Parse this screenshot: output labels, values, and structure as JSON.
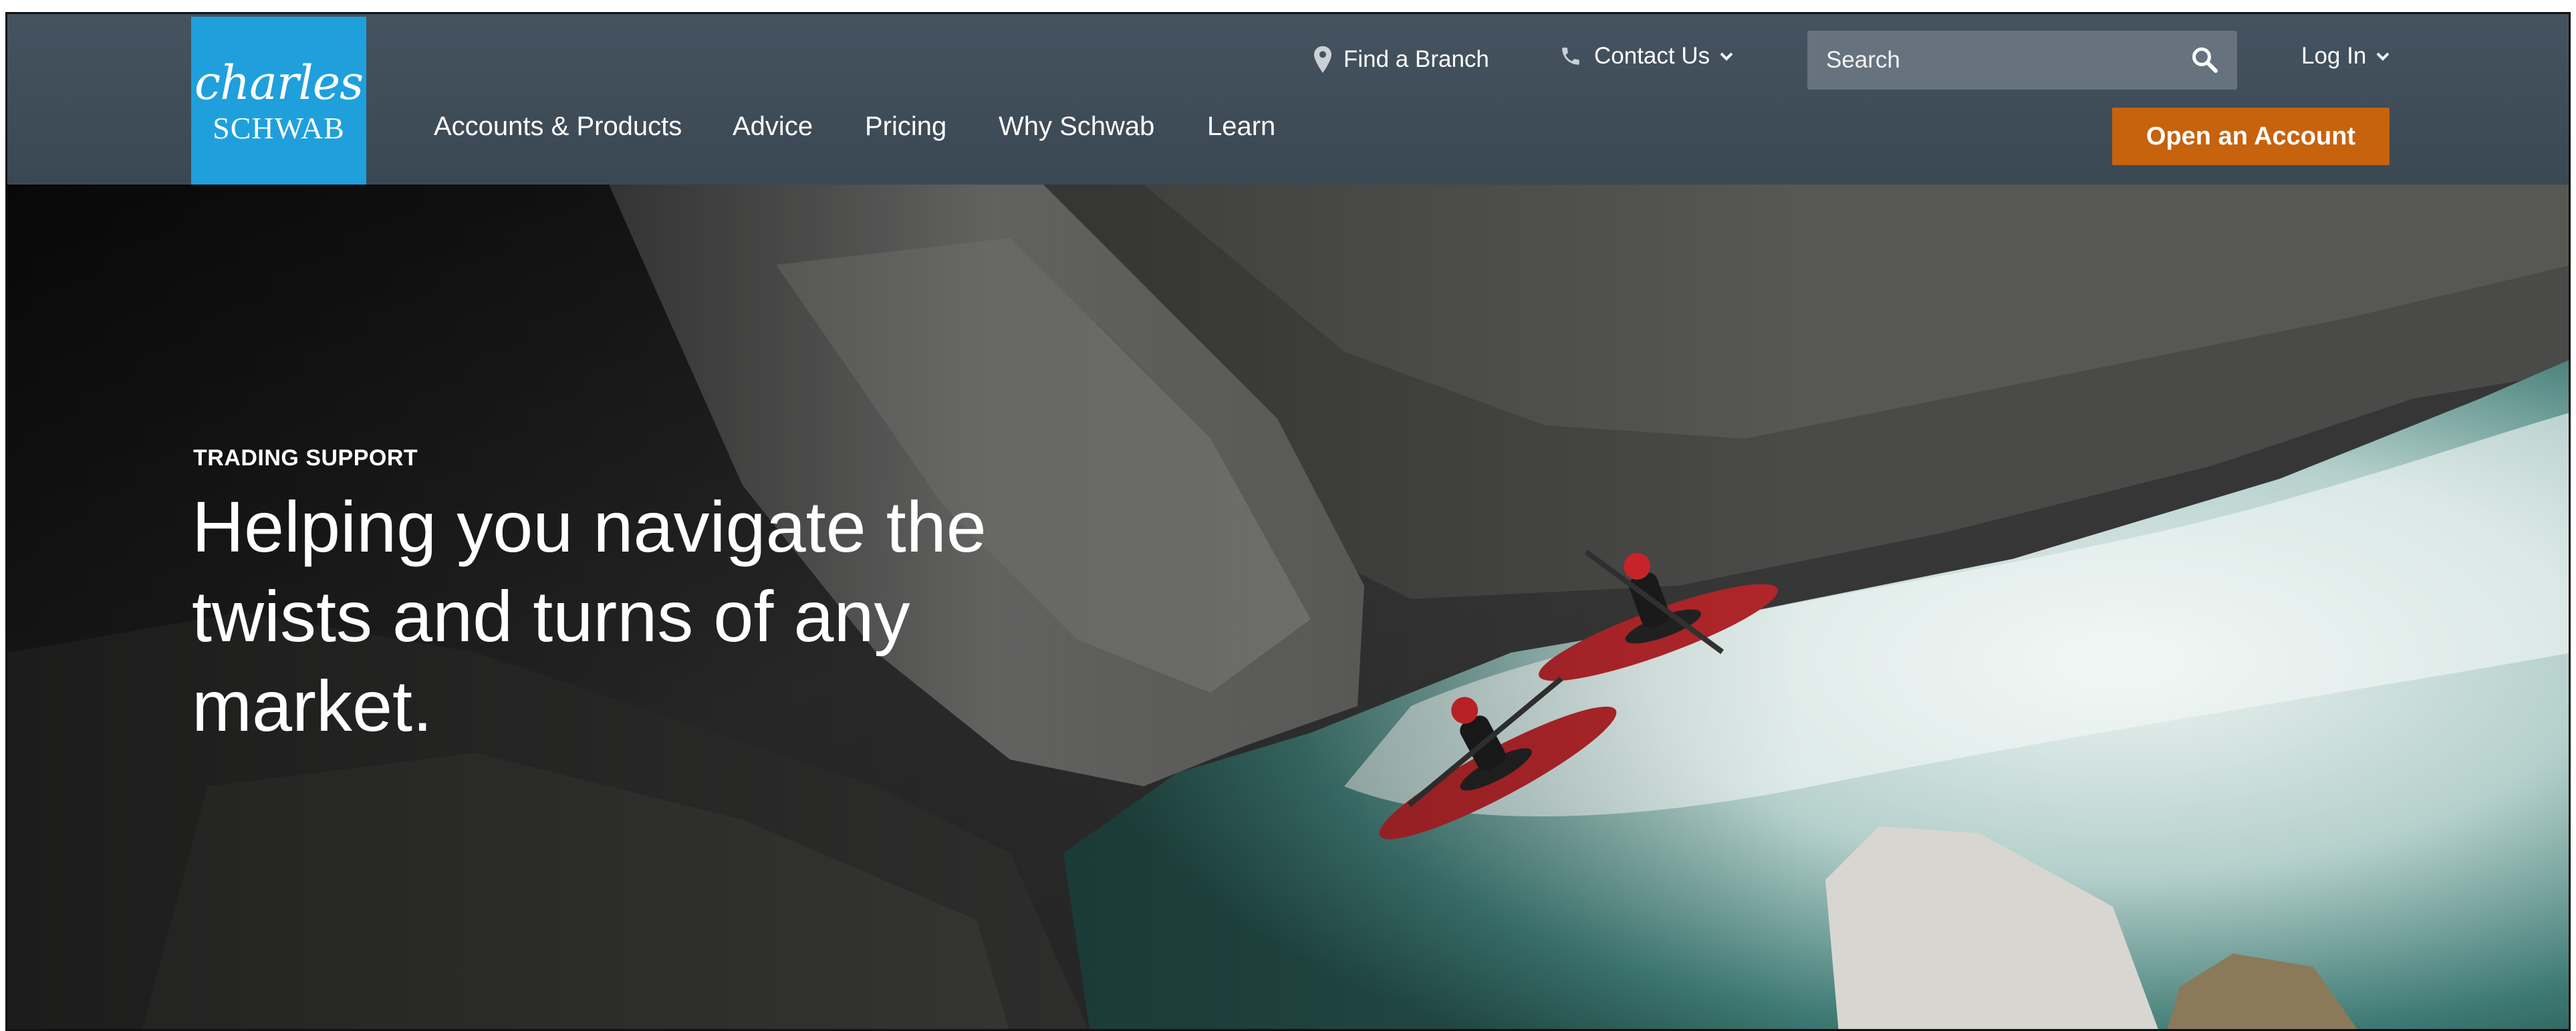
{
  "brand": {
    "logo_line1": "charles",
    "logo_line2": "SCHWAB",
    "color_primary": "#1fa0dc",
    "color_cta": "#c7620d",
    "color_header": "#3d4b57"
  },
  "utility_nav": {
    "find_branch": {
      "label": "Find a Branch",
      "icon": "location-pin-icon"
    },
    "contact_us": {
      "label": "Contact Us",
      "icon": "phone-icon"
    },
    "search": {
      "placeholder": "Search",
      "icon": "search-icon"
    },
    "login": {
      "label": "Log In"
    }
  },
  "main_nav": {
    "items": [
      {
        "label": "Accounts & Products"
      },
      {
        "label": "Advice"
      },
      {
        "label": "Pricing"
      },
      {
        "label": "Why Schwab"
      },
      {
        "label": "Learn"
      }
    ],
    "cta_label": "Open an Account"
  },
  "hero": {
    "eyebrow": "TRADING SUPPORT",
    "headline_lines": [
      "Helping you navigate the",
      "twists and turns of any",
      "market."
    ]
  }
}
